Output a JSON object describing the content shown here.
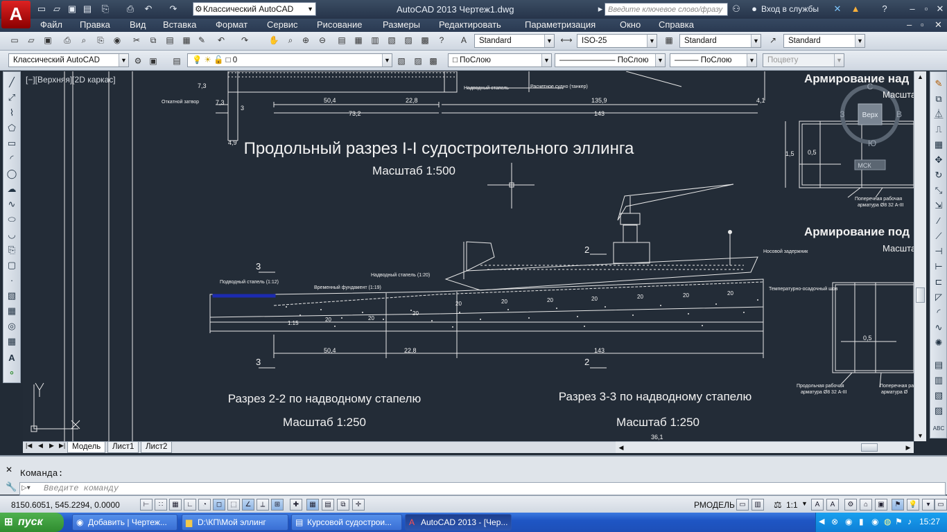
{
  "window": {
    "title": "AutoCAD 2013   Чертеж1.dwg",
    "workspace": "Классический AutoCAD",
    "search_placeholder": "Введите ключевое слово/фразу",
    "signin": "Вход в службы"
  },
  "menu": [
    "Файл",
    "Правка",
    "Вид",
    "Вставка",
    "Формат",
    "Сервис",
    "Рисование",
    "Размеры",
    "Редактировать",
    "Параметризация",
    "Окно",
    "Справка"
  ],
  "styles": {
    "text_style": "Standard",
    "dim_style": "ISO-25",
    "table_style": "Standard",
    "mleader_style": "Standard"
  },
  "layers": {
    "workspace": "Классический AutoCAD",
    "layer": "0",
    "color": "ПоСлою",
    "linetype": "ПоСлою",
    "lineweight": "ПоСлою",
    "plotstyle": "Поцвету"
  },
  "viewport": {
    "label": "[−][Верхняя][2D каркас]",
    "viewcube": {
      "top": "Верх",
      "n": "С",
      "s": "Ю",
      "w": "З",
      "e": "В",
      "wcs": "МСК"
    }
  },
  "drawing": {
    "main_title": "Продольный разрез I-I судостроительного эллинга",
    "main_scale": "Масштаб 1:500",
    "section22": "Разрез 2-2 по надводному стапелю",
    "section22_scale": "Масштаб 1:250",
    "section33": "Разрез 3-3 по надводному стапелю",
    "section33_scale": "Масштаб 1:250",
    "arm1": "Армирование над",
    "arm1_scale": "Масшта",
    "arm2": "Армирование под",
    "arm2_scale": "Масшта",
    "top_labels": {
      "otk": "Откатной затвор",
      "nadv": "Надводный стапель",
      "rasch": "Расчетное судно (танкер)"
    },
    "top_dims": {
      "d1": "7,3",
      "d2": "7,3",
      "d3": "3",
      "d4": "4,9",
      "d5": "50,4",
      "d6": "22,8",
      "d7": "73,2",
      "d8": "135,9",
      "d9": "143",
      "d10": "4,1"
    },
    "mid_labels": {
      "podv": "Подводный стапель (1:12)",
      "vrem": "Временный фундамент (1:19)",
      "nadv": "Надводный стапель (1:20)",
      "nos": "Носовой задержник",
      "teplo": "Температурно-осадочный шов"
    },
    "bottom_dims": {
      "a": "50,4",
      "b": "22,8",
      "c": "143",
      "d": "36,1"
    },
    "section_marks": {
      "s3": "3",
      "s2": "2"
    },
    "grade_labels": [
      "20",
      "20",
      "20",
      "20",
      "20",
      "20",
      "20",
      "20",
      "20",
      "20",
      "1:15"
    ],
    "right_labels": {
      "pop": "Поперечная рабочая",
      "arm": "арматура Ø8 32 А-III",
      "prod": "Продольная рабочая",
      "prod2": "арматура Ø8 32 А-III",
      "pop2": "Поперечная раб",
      "arm2": "арматура Ø"
    },
    "right_dims": {
      "h": "1,5",
      "w": "0,5",
      "w2": "0,5"
    }
  },
  "layout_tabs": [
    "Модель",
    "Лист1",
    "Лист2"
  ],
  "command": {
    "label": "Команда:",
    "placeholder": "Введите команду"
  },
  "status": {
    "coords": "8150.6051, 545.2294, 0.0000",
    "model": "РМОДЕЛЬ",
    "scale": "1:1"
  },
  "taskbar": {
    "start": "пуск",
    "tasks": [
      "Добавить | Чертеж...",
      "D:\\КП\\Мой эллинг",
      "Курсовой судострои...",
      "AutoCAD 2013 - [Чер..."
    ],
    "clock": "15:27"
  },
  "colors": {
    "canvas": "#232c37",
    "line": "#ffffff",
    "accent_blue": "#1c2bb0",
    "title_bg": "#2c3d55"
  }
}
